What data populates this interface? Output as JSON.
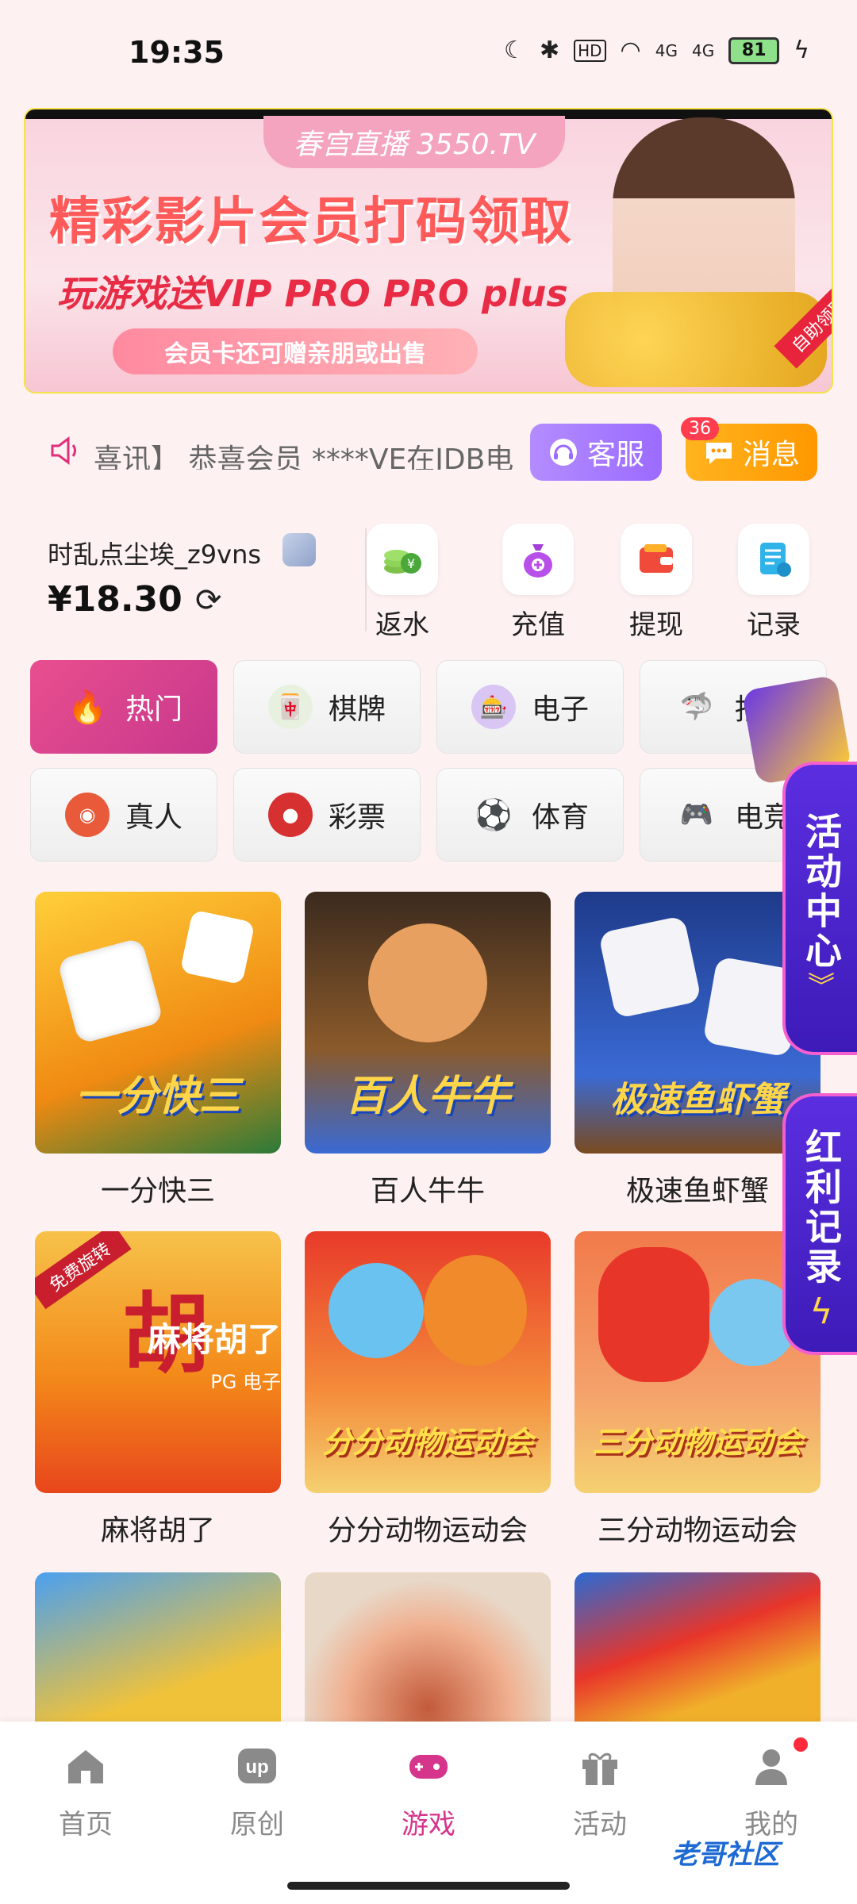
{
  "status": {
    "time": "19:35",
    "battery": "81",
    "signal1": "4G",
    "signal2": "4G",
    "hd": "HD"
  },
  "banner": {
    "tag": "春宫直播 3550.TV",
    "headline": "精彩影片会员打码领取",
    "sub": "玩游戏送VIP PRO PRO plus",
    "pill": "会员卡还可赠亲朋或出售",
    "corner": "自助领取"
  },
  "news": {
    "marquee": "喜讯】 恭喜会员 ****VE在JDB电",
    "service_label": "客服",
    "message_label": "消息",
    "message_count": "36"
  },
  "user": {
    "name": "时乱点尘埃_z9vns",
    "balance": "¥18.30"
  },
  "actions": [
    {
      "label": "返水",
      "icon": "coins-icon"
    },
    {
      "label": "充值",
      "icon": "money-bag-icon"
    },
    {
      "label": "提现",
      "icon": "wallet-icon"
    },
    {
      "label": "记录",
      "icon": "record-icon"
    }
  ],
  "categories": [
    {
      "label": "热门",
      "icon": "flame-icon"
    },
    {
      "label": "棋牌",
      "icon": "mahjong-icon"
    },
    {
      "label": "电子",
      "icon": "slot-icon"
    },
    {
      "label": "捕鱼",
      "icon": "fish-icon"
    },
    {
      "label": "真人",
      "icon": "chip-icon"
    },
    {
      "label": "彩票",
      "icon": "lottery-ball-icon"
    },
    {
      "label": "体育",
      "icon": "soccer-icon"
    },
    {
      "label": "电竞",
      "icon": "gamepad-icon"
    }
  ],
  "games": [
    {
      "name": "一分快三",
      "art": "一分快三"
    },
    {
      "name": "百人牛牛",
      "art": "百人牛牛"
    },
    {
      "name": "极速鱼虾蟹",
      "art": "极速鱼虾蟹"
    },
    {
      "name": "麻将胡了",
      "art": "麻将胡了",
      "sub": "PG 电子",
      "ribbon": "免费旋转"
    },
    {
      "name": "分分动物运动会",
      "art": "分分动物运动会"
    },
    {
      "name": "三分动物运动会",
      "art": "三分动物运动会"
    }
  ],
  "floaters": {
    "activity": "活动中心",
    "redpacket": "红利记录"
  },
  "nav": [
    {
      "label": "首页",
      "icon": "home-icon"
    },
    {
      "label": "原创",
      "icon": "up-icon"
    },
    {
      "label": "游戏",
      "icon": "gamepad-icon"
    },
    {
      "label": "活动",
      "icon": "gift-icon"
    },
    {
      "label": "我的",
      "icon": "user-icon"
    }
  ],
  "watermark": "老哥社区",
  "colors": {
    "accent": "#d6358c",
    "background": "#fdf1f1",
    "service": "#9b6bff",
    "message": "#ff9800"
  }
}
